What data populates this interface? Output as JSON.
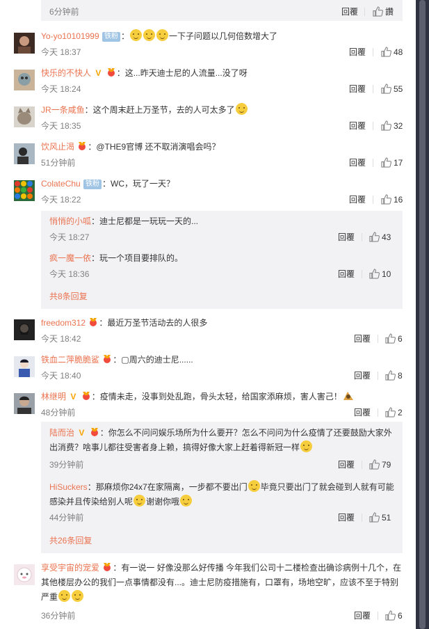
{
  "top": {
    "time": "6分钟前",
    "reply": "回覆",
    "like": "讚"
  },
  "badge_fan": "铁粉",
  "comments": [
    {
      "user": "Yo-yo10101999",
      "text": "一下子问题以几何倍数增大了",
      "time": "今天 18:37",
      "reply": "回覆",
      "likes": "48"
    },
    {
      "user": "快乐的不快人",
      "text": "：这...昨天迪士尼的人流量...没了呀",
      "time": "今天 18:24",
      "reply": "回覆",
      "likes": "55"
    },
    {
      "user": "JR一条咸鱼",
      "text": "：这个周末赶上万圣节，去的人可太多了",
      "time": "今天 18:35",
      "reply": "回覆",
      "likes": "32"
    },
    {
      "user": "饮风止渴",
      "text": "：@THE9官博 还不取消演唱会吗？",
      "time": "51分钟前",
      "reply": "回覆",
      "likes": "17"
    },
    {
      "user": "ColateChu",
      "text": "：WC，玩了一天？",
      "time": "今天 18:22",
      "reply": "回覆",
      "likes": "16",
      "subs": [
        {
          "user": "悄悄的小呱",
          "text": "：迪士尼都是一玩玩一天的...",
          "time": "今天 18:27",
          "reply": "回覆",
          "likes": "43"
        },
        {
          "user": "疯一魔一依",
          "text": "：玩一个项目要排队的。",
          "time": "今天 18:36",
          "reply": "回覆",
          "likes": "10"
        }
      ],
      "more": "共8条回复"
    },
    {
      "user": "freedom312",
      "text": "：最近万圣节活动去的人很多",
      "time": "今天 18:42",
      "reply": "回覆",
      "likes": "6"
    },
    {
      "user": "铁血二萍脆脆鲨",
      "text": "：▢周六的迪士尼......",
      "time": "今天 18:40",
      "reply": "回覆",
      "likes": "8"
    },
    {
      "user": "林继明",
      "text": "：疫情未走，没事到处乱跑，骨头太轻，给国家添麻烦，害人害己！",
      "time": "48分钟前",
      "reply": "回覆",
      "likes": "2",
      "subs": [
        {
          "user": "陆而治",
          "text": "：你怎么不问问娱乐场所为什么要开？怎么不问问为什么疫情了还要鼓励大家外出消费？啥事儿都往受害者身上赖，搞得好像大家上赶着得新冠一样",
          "time": "39分钟前",
          "reply": "回覆",
          "likes": "79"
        },
        {
          "user": "HiSuckers",
          "text_a": "：那麻烦你24x7在家隔离，一步都不要出门",
          "text_b": "毕竟只要出门了就会碰到人就有可能感染并且传染给别人呢",
          "text_c": "谢谢你哦",
          "time": "44分钟前",
          "reply": "回覆",
          "likes": "51"
        }
      ],
      "more": "共26条回复"
    },
    {
      "user": "享受宇宙的宠爱",
      "text": "：有一说一 好像没那么好传播 今年我们公司十二楼检查出确诊病例十几个，在其他楼层办公的我们一点事情都没有...。迪士尼防疫措施有，口罩有，场地空旷，应该不至于特别严重",
      "time": "36分钟前",
      "reply": "回覆",
      "likes": "6"
    }
  ],
  "colors": {
    "username": "#eb7350",
    "subbox": "#f2f2f5",
    "meta": "#808080",
    "fan_badge": "#a0c4e4"
  }
}
